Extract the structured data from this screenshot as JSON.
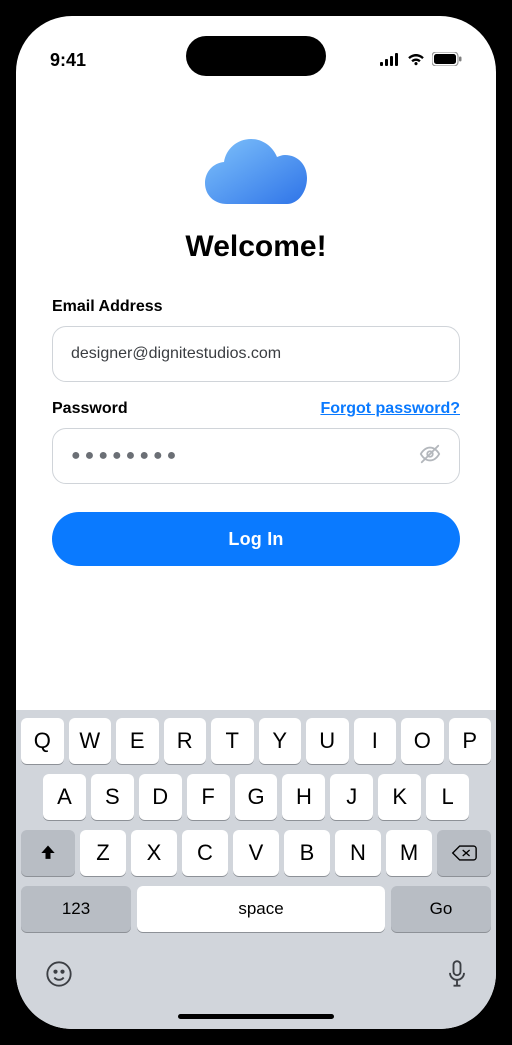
{
  "status": {
    "time": "9:41"
  },
  "header": {
    "title": "Welcome!"
  },
  "form": {
    "email_label": "Email Address",
    "email_value": "designer@dignitestudios.com",
    "password_label": "Password",
    "forgot_label": "Forgot password?",
    "password_mask": "●●●●●●●●",
    "login_label": "Log In"
  },
  "keyboard": {
    "row1": [
      "Q",
      "W",
      "E",
      "R",
      "T",
      "Y",
      "U",
      "I",
      "O",
      "P"
    ],
    "row2": [
      "A",
      "S",
      "D",
      "F",
      "G",
      "H",
      "J",
      "K",
      "L"
    ],
    "row3": [
      "Z",
      "X",
      "C",
      "V",
      "B",
      "N",
      "M"
    ],
    "switch_label": "123",
    "space_label": "space",
    "go_label": "Go"
  }
}
